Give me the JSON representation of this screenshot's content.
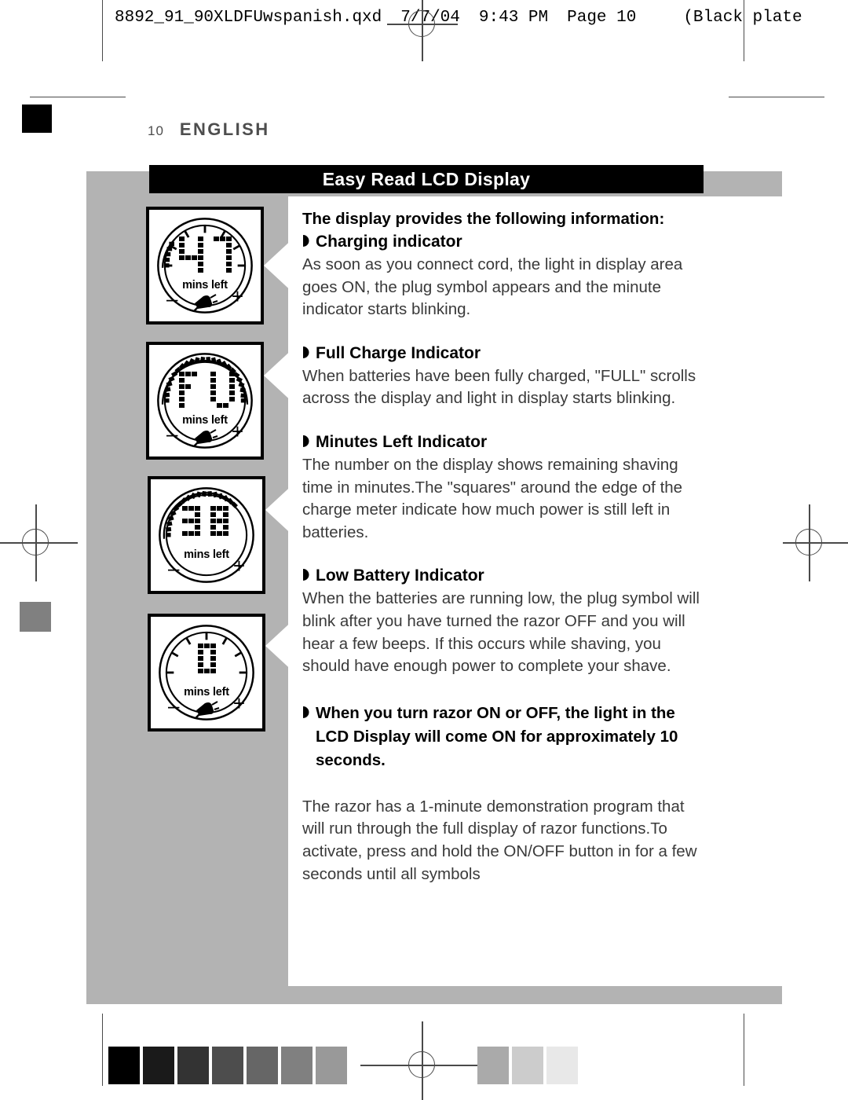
{
  "slug": {
    "filename": "8892_91_90XLDFUwspanish.qxd",
    "date": "7/7/04",
    "time": "9:43 PM",
    "page": "Page 10",
    "plate": "(Black plate"
  },
  "running_head": {
    "folio": "10",
    "language": "ENGLISH"
  },
  "banner": {
    "title": "Easy Read LCD Display"
  },
  "figures": [
    {
      "name": "charging-indicator-display",
      "digits": "14",
      "label": "mins left",
      "minus": "–",
      "plus": "+",
      "plug_visible": true,
      "meter_style": "partial-left",
      "meter_percent": 12
    },
    {
      "name": "full-charge-display",
      "digits": "FU",
      "label": "mins left",
      "minus": "–",
      "plus": "+",
      "plug_visible": true,
      "meter_style": "full",
      "meter_percent": 100
    },
    {
      "name": "minutes-left-display",
      "digits": "38",
      "label": "mins left",
      "minus": "–",
      "plus": "+",
      "plug_visible": false,
      "meter_style": "three-quarter",
      "meter_percent": 75
    },
    {
      "name": "low-battery-display",
      "digits": "0",
      "label": "mins left",
      "minus": "–",
      "plus": "+",
      "plug_visible": true,
      "meter_style": "empty",
      "meter_percent": 0
    }
  ],
  "content": {
    "intro": "The display provides the following information:",
    "sections": [
      {
        "heading": "Charging indicator",
        "body": "As soon as you connect cord, the light in display area goes ON, the plug symbol appears and the minute indicator starts blinking."
      },
      {
        "heading": "Full Charge Indicator",
        "body": "When batteries have been fully charged, \"FULL\" scrolls across the display and light in display starts blinking."
      },
      {
        "heading": "Minutes Left Indicator",
        "body": "The number on the display shows remaining shaving time in minutes.The \"squares\" around the edge of the charge meter indicate how much power is still left in batteries."
      },
      {
        "heading": "Low Battery Indicator",
        "body": "When the batteries are running low, the plug symbol will blink after you have turned the razor OFF and you will hear a few beeps. If this occurs while shaving, you should have enough power to complete your shave."
      }
    ],
    "bold_note": "When you turn razor ON or OFF, the light in the LCD Display will come ON for approximately 10 seconds.",
    "closing": "The razor has a 1-minute demonstration program that will run through the full display of razor functions.To activate, press and hold the ON/OFF button in for a few seconds until all symbols"
  },
  "colors": {
    "plate_gray": "#b3b3b3",
    "banner_black": "#000000",
    "head_gray": "#4d4d4d",
    "body_gray": "#3a3a3a"
  },
  "calibration": {
    "swatches_left": [
      "#000000",
      "#1a1a1a",
      "#333333",
      "#4d4d4d",
      "#666666",
      "#808080",
      "#999999"
    ],
    "swatches_right": [
      "#aaaaaa",
      "#cccccc",
      "#e8e8e8"
    ]
  }
}
